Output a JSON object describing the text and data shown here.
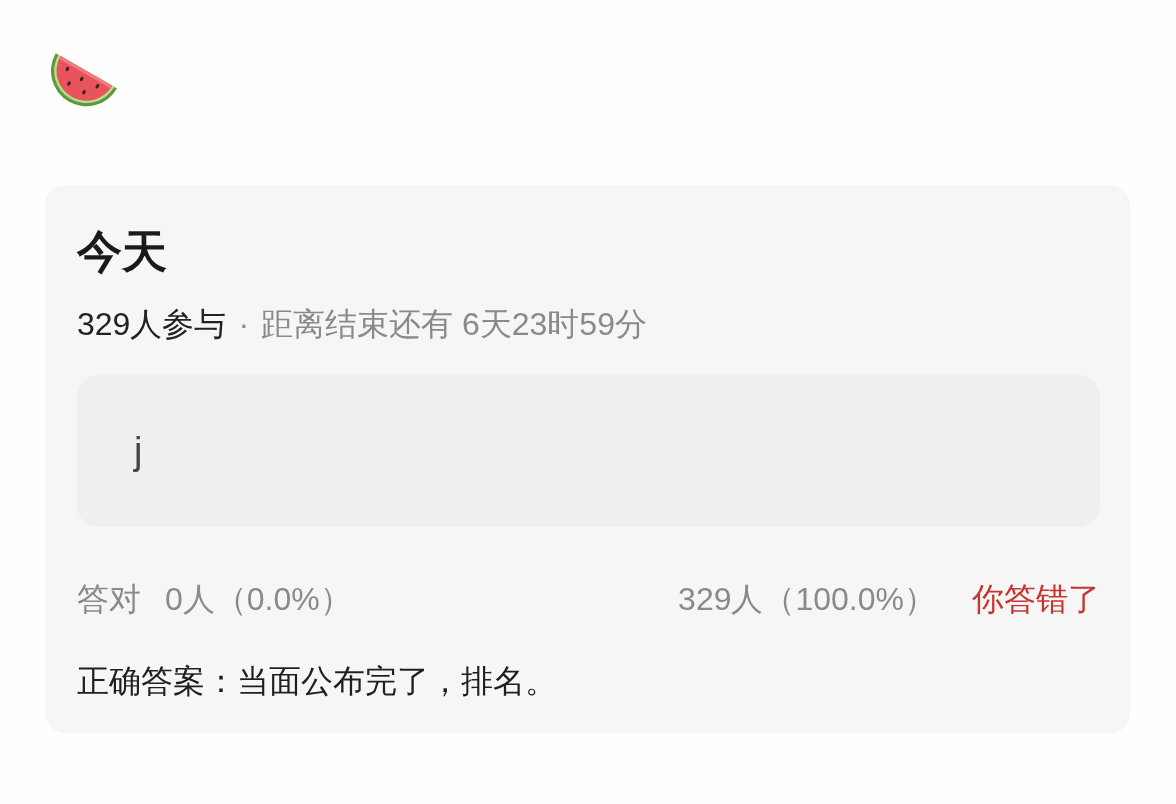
{
  "card": {
    "title": "今天",
    "meta": {
      "participants": "329人参与",
      "separator": "·",
      "countdown": "距离结束还有 6天23时59分"
    },
    "answer": {
      "value": "j"
    },
    "stats": {
      "correct_label": "答对",
      "correct_count": "0人（0.0%）",
      "wrong_count": "329人（100.0%）",
      "result": {
        "text": "你答错了",
        "correct": false
      }
    },
    "solution": "正确答案：当面公布完了，排名。"
  }
}
